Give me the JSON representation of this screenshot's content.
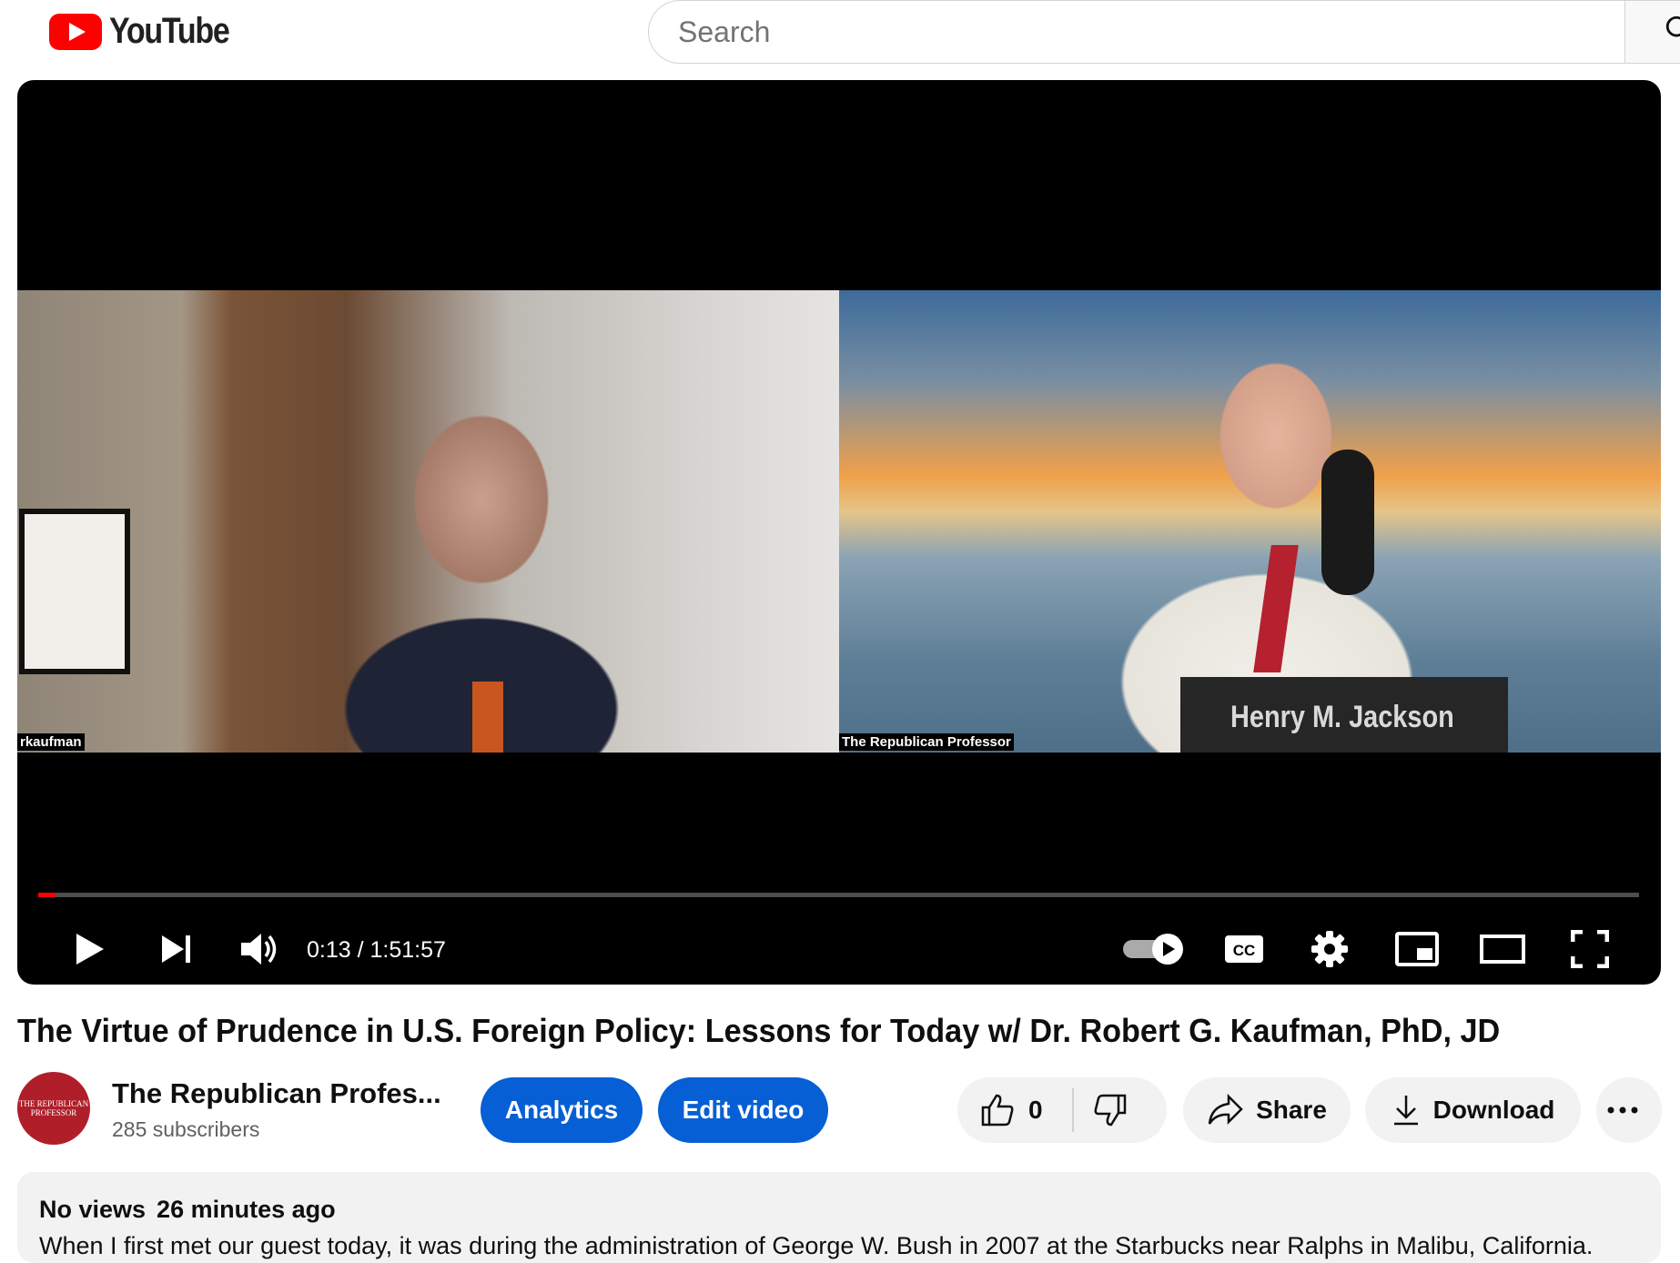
{
  "header": {
    "logo_text": "YouTube",
    "search_placeholder": "Search"
  },
  "player": {
    "left_name_tag": "rkaufman",
    "right_name_tag": "The Republican Professor",
    "book_title": "Henry M. Jackson",
    "time_display": "0:13 / 1:51:57",
    "progress": 0.011
  },
  "video": {
    "title": "The Virtue of Prudence in U.S. Foreign Policy: Lessons for Today w/ Dr. Robert G. Kaufman, PhD, JD",
    "channel_name": "The Republican Profes...",
    "avatar_text": "THE REPUBLICAN PROFESSOR",
    "subscribers": "285 subscribers",
    "analytics_label": "Analytics",
    "edit_label": "Edit video",
    "like_count": "0",
    "share_label": "Share",
    "download_label": "Download"
  },
  "description": {
    "views": "No views",
    "age": "26 minutes ago",
    "text": "When I first met our guest today, it was during the administration of George W. Bush in 2007 at the Starbucks near Ralphs in Malibu, California."
  },
  "colors": {
    "brand_red": "#ff0000",
    "action_blue": "#065fd4",
    "chip_grey": "#f2f2f2"
  }
}
